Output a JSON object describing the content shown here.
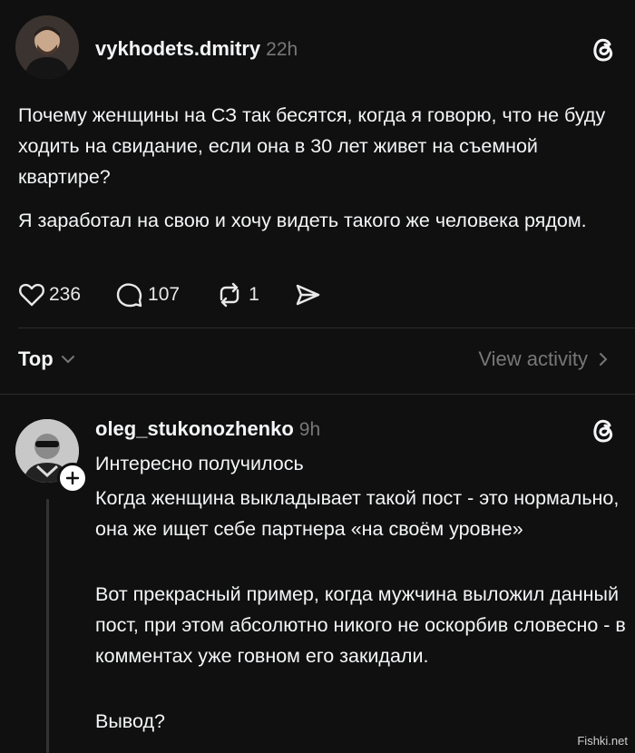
{
  "post": {
    "username": "vykhodets.dmitry",
    "time": "22h",
    "paragraphs": [
      "Почему женщины на СЗ так бесятся, когда я говорю, что не буду ходить на свидание, если она в 30 лет живет на съемной квартире?",
      "Я заработал на свою и хочу видеть такого же человека рядом."
    ],
    "likes": "236",
    "comments": "107",
    "reposts": "1"
  },
  "sort": {
    "label": "Top",
    "view_activity": "View activity"
  },
  "reply": {
    "username": "oleg_stukonozhenko",
    "time": "9h",
    "lines": [
      "Интересно получилось",
      "Когда женщина выкладывает такой пост - это нормально, она же ищет себе партнера «на своём уровне»",
      "Вот прекрасный пример, когда мужчина выложил данный пост, при этом абсолютно никого не оскорбив словесно - в комментах уже говном его закидали.",
      "Вывод?"
    ]
  },
  "watermark": "Fishki.net",
  "icons": [
    "threads-icon",
    "heart-icon",
    "comment-icon",
    "repost-icon",
    "share-icon",
    "chevron-down-icon",
    "chevron-right-icon",
    "follow-plus-icon"
  ]
}
